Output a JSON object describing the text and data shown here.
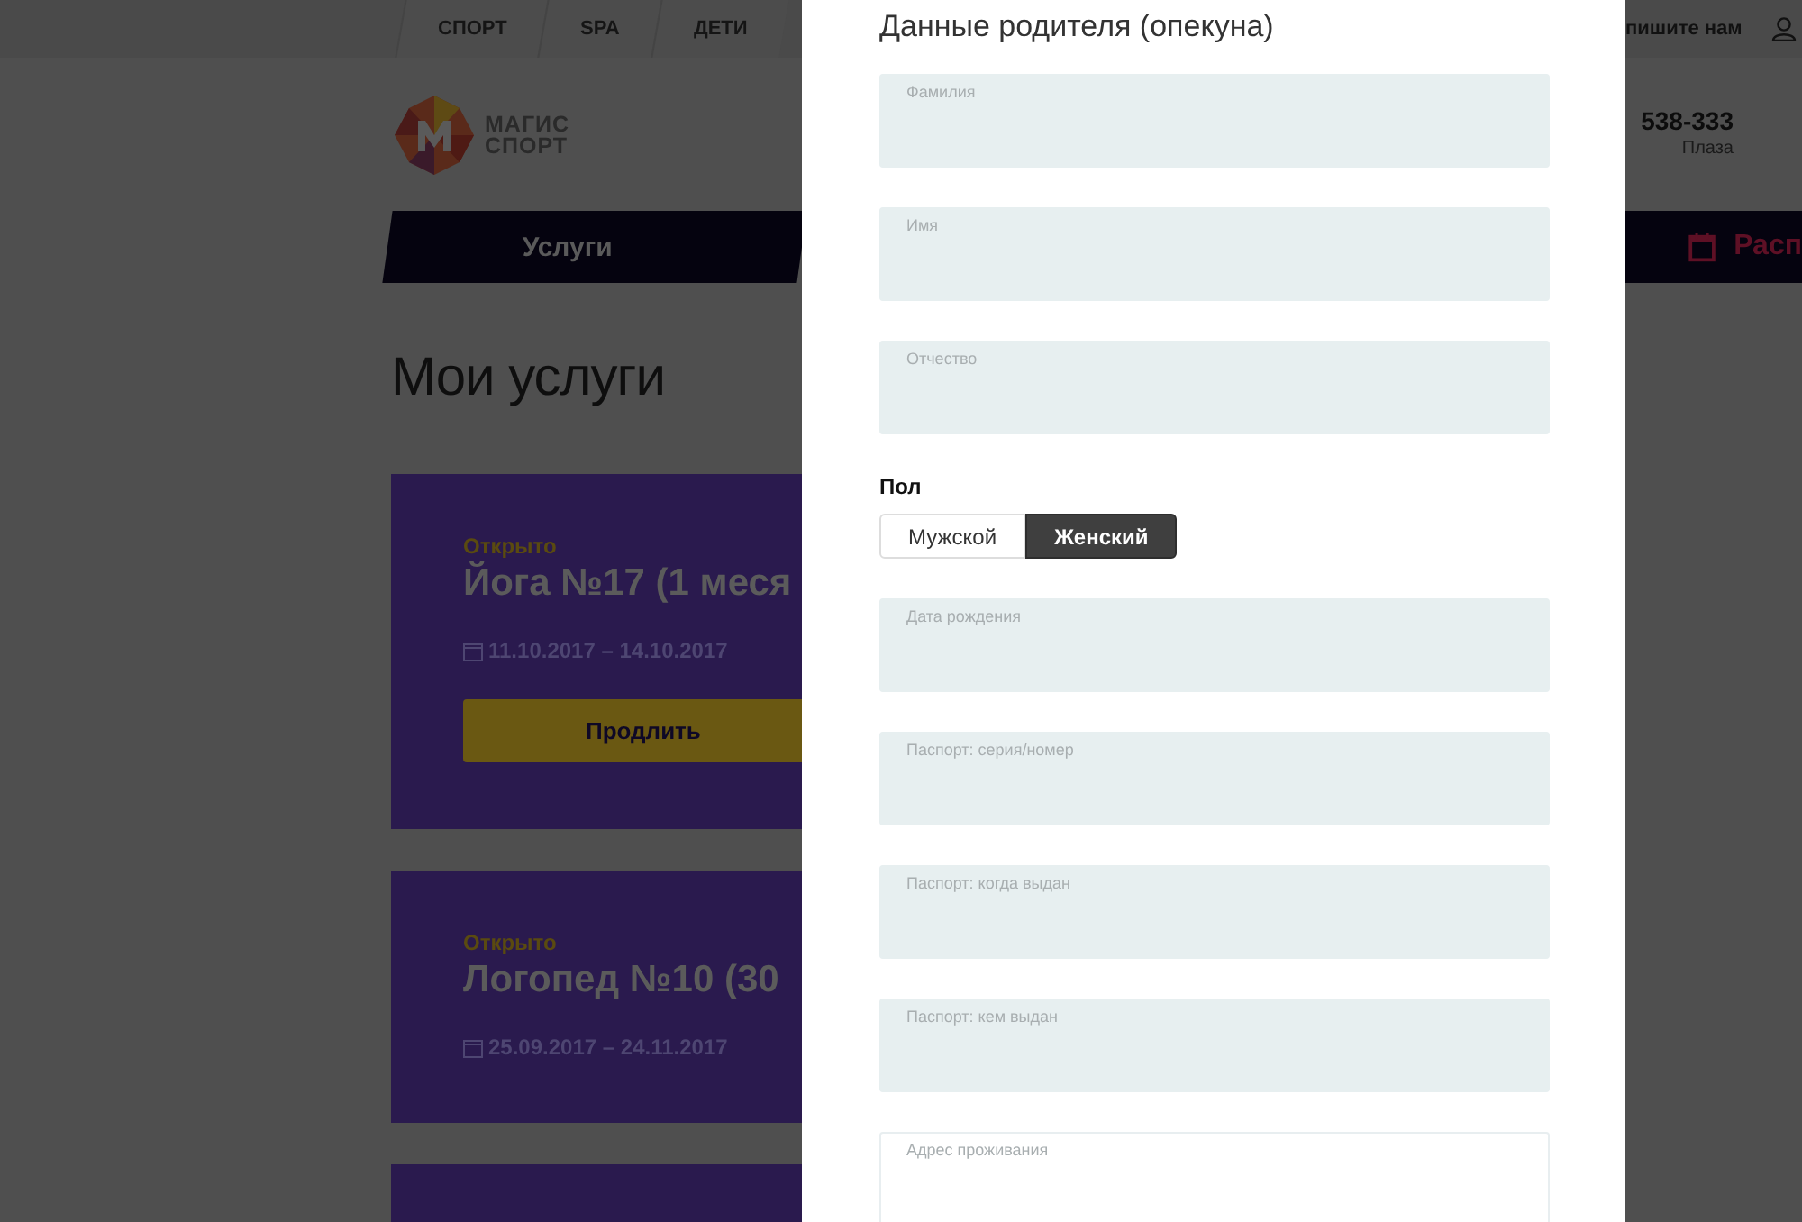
{
  "top_nav": [
    {
      "label": "СПОРТ"
    },
    {
      "label": "SPA"
    },
    {
      "label": "ДЕТИ"
    }
  ],
  "top_right_link": "пишите нам",
  "logo": {
    "line1": "МАГИС",
    "line2": "СПОРТ"
  },
  "phone": {
    "number": "538-333",
    "caption": "Плаза"
  },
  "main_nav": [
    {
      "label": "Услуги"
    }
  ],
  "main_nav_right": "Расп",
  "heading": "Мои услуги",
  "services": [
    {
      "kind": "service",
      "status": "Открыто",
      "title": "Йога №17 (1 меся",
      "dates": "11.10.2017 – 14.10.2017",
      "action": "Продлить"
    },
    {
      "kind": "service",
      "status": "Открыто",
      "title": "Логопед №10 (30",
      "dates": "25.09.2017 – 24.11.2017"
    },
    {
      "kind": "service"
    }
  ],
  "modal": {
    "title": "Данные родителя (опекуна)",
    "form": [
      {
        "kind": "field",
        "label": "Фамилия"
      },
      {
        "kind": "field",
        "label": "Имя"
      },
      {
        "kind": "field",
        "label": "Отчество"
      },
      {
        "kind": "toggle",
        "label": "Пол",
        "options": [
          {
            "label": "Мужской",
            "selected": false
          },
          {
            "label": "Женский",
            "selected": true
          }
        ]
      },
      {
        "kind": "field",
        "label": "Дата рождения"
      },
      {
        "kind": "field",
        "label": "Паспорт: серия/номер"
      },
      {
        "kind": "field",
        "label": "Паспорт: когда выдан"
      },
      {
        "kind": "field",
        "label": "Паспорт: кем выдан"
      },
      {
        "kind": "textarea",
        "label": "Адрес проживания"
      }
    ]
  }
}
